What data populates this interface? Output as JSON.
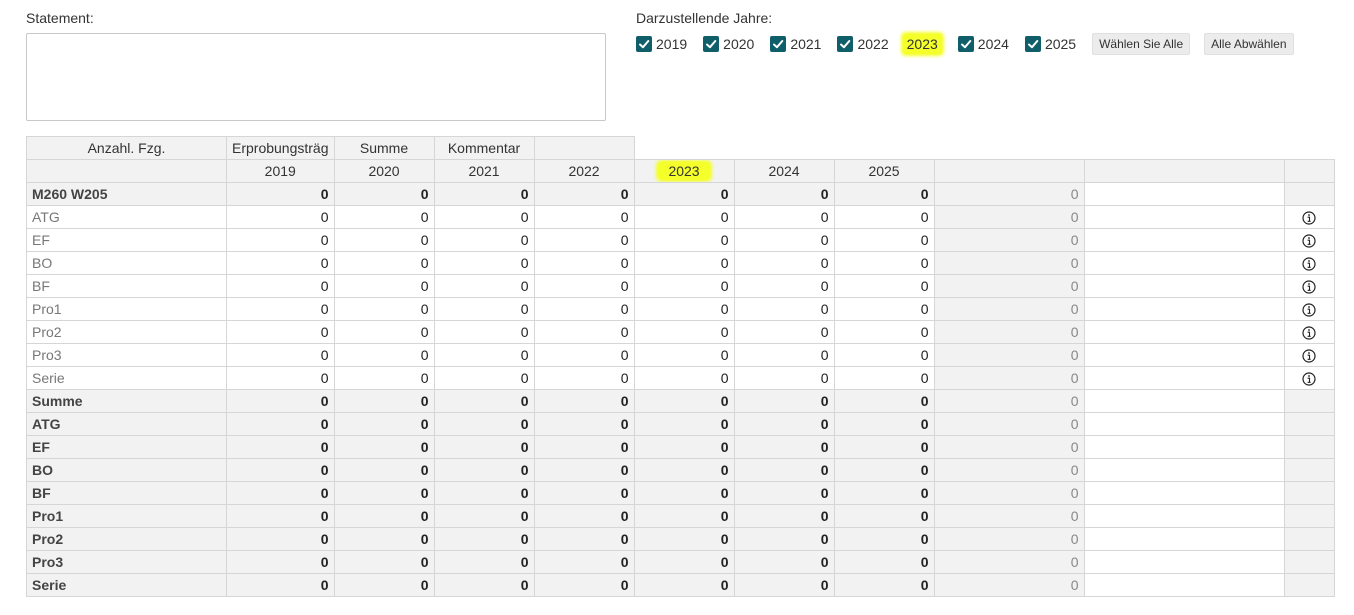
{
  "statement": {
    "label": "Statement:",
    "value": ""
  },
  "years": {
    "label": "Darzustellende Jahre:",
    "items": [
      {
        "year": "2019",
        "checked": true
      },
      {
        "year": "2020",
        "checked": true
      },
      {
        "year": "2021",
        "checked": true
      },
      {
        "year": "2022",
        "checked": true
      },
      {
        "year": "2023",
        "checked": true
      },
      {
        "year": "2024",
        "checked": true
      },
      {
        "year": "2025",
        "checked": true
      }
    ],
    "select_all": "Wählen Sie Alle",
    "deselect_all": "Alle Abwählen"
  },
  "colors": {
    "accent": "#0f5e6a",
    "highlight": "#f5ff2a",
    "header_bg": "#f2f2f2",
    "border": "#d6d6d6"
  },
  "table": {
    "header_row1": [
      "Anzahl. Fzg.",
      "Erprobungsträg",
      "Summe",
      "Kommentar",
      ""
    ],
    "header_row2": [
      "",
      "2019",
      "2020",
      "2021",
      "2022",
      "2023",
      "2024",
      "2025",
      "",
      "",
      ""
    ],
    "rows": [
      {
        "label": "M260 W205",
        "bold": true,
        "values": [
          "0",
          "0",
          "0",
          "0",
          "0",
          "0",
          "0"
        ],
        "sum": "0",
        "info": false
      },
      {
        "label": "ATG",
        "bold": false,
        "values": [
          "0",
          "0",
          "0",
          "0",
          "0",
          "0",
          "0"
        ],
        "sum": "0",
        "info": true
      },
      {
        "label": "EF",
        "bold": false,
        "values": [
          "0",
          "0",
          "0",
          "0",
          "0",
          "0",
          "0"
        ],
        "sum": "0",
        "info": true
      },
      {
        "label": "BO",
        "bold": false,
        "values": [
          "0",
          "0",
          "0",
          "0",
          "0",
          "0",
          "0"
        ],
        "sum": "0",
        "info": true
      },
      {
        "label": "BF",
        "bold": false,
        "values": [
          "0",
          "0",
          "0",
          "0",
          "0",
          "0",
          "0"
        ],
        "sum": "0",
        "info": true
      },
      {
        "label": "Pro1",
        "bold": false,
        "values": [
          "0",
          "0",
          "0",
          "0",
          "0",
          "0",
          "0"
        ],
        "sum": "0",
        "info": true
      },
      {
        "label": "Pro2",
        "bold": false,
        "values": [
          "0",
          "0",
          "0",
          "0",
          "0",
          "0",
          "0"
        ],
        "sum": "0",
        "info": true
      },
      {
        "label": "Pro3",
        "bold": false,
        "values": [
          "0",
          "0",
          "0",
          "0",
          "0",
          "0",
          "0"
        ],
        "sum": "0",
        "info": true
      },
      {
        "label": "Serie",
        "bold": false,
        "values": [
          "0",
          "0",
          "0",
          "0",
          "0",
          "0",
          "0"
        ],
        "sum": "0",
        "info": true
      },
      {
        "label": "Summe",
        "bold": true,
        "values": [
          "0",
          "0",
          "0",
          "0",
          "0",
          "0",
          "0"
        ],
        "sum": "0",
        "info": false
      },
      {
        "label": "ATG",
        "bold": true,
        "values": [
          "0",
          "0",
          "0",
          "0",
          "0",
          "0",
          "0"
        ],
        "sum": "0",
        "info": false
      },
      {
        "label": "EF",
        "bold": true,
        "values": [
          "0",
          "0",
          "0",
          "0",
          "0",
          "0",
          "0"
        ],
        "sum": "0",
        "info": false
      },
      {
        "label": "BO",
        "bold": true,
        "values": [
          "0",
          "0",
          "0",
          "0",
          "0",
          "0",
          "0"
        ],
        "sum": "0",
        "info": false
      },
      {
        "label": "BF",
        "bold": true,
        "values": [
          "0",
          "0",
          "0",
          "0",
          "0",
          "0",
          "0"
        ],
        "sum": "0",
        "info": false
      },
      {
        "label": "Pro1",
        "bold": true,
        "values": [
          "0",
          "0",
          "0",
          "0",
          "0",
          "0",
          "0"
        ],
        "sum": "0",
        "info": false
      },
      {
        "label": "Pro2",
        "bold": true,
        "values": [
          "0",
          "0",
          "0",
          "0",
          "0",
          "0",
          "0"
        ],
        "sum": "0",
        "info": false
      },
      {
        "label": "Pro3",
        "bold": true,
        "values": [
          "0",
          "0",
          "0",
          "0",
          "0",
          "0",
          "0"
        ],
        "sum": "0",
        "info": false
      },
      {
        "label": "Serie",
        "bold": true,
        "values": [
          "0",
          "0",
          "0",
          "0",
          "0",
          "0",
          "0"
        ],
        "sum": "0",
        "info": false
      }
    ]
  }
}
